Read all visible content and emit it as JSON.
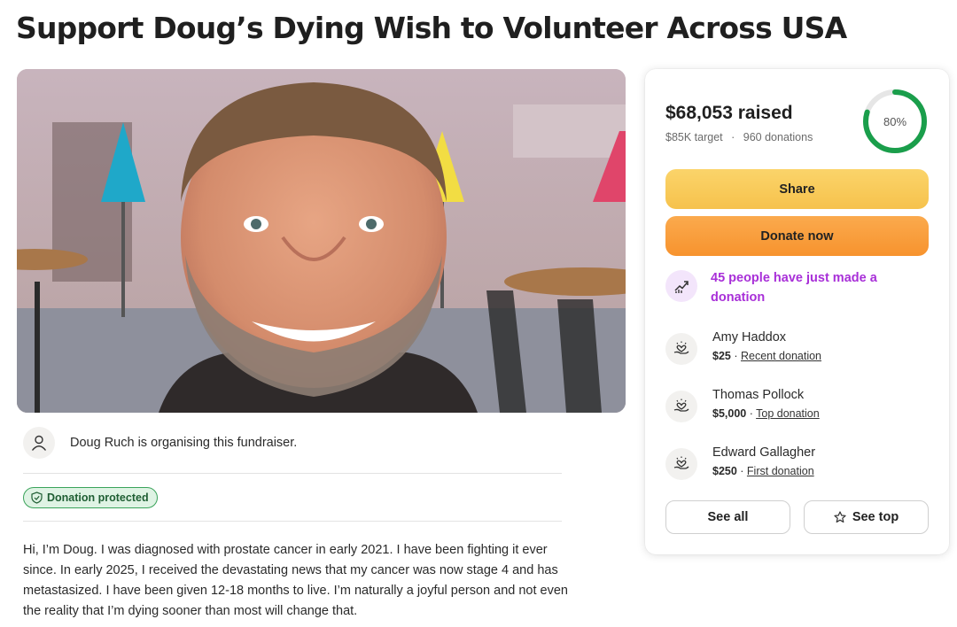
{
  "page": {
    "title": "Support Doug’s Dying Wish to Volunteer Across USA"
  },
  "organiser": {
    "text": "Doug Ruch is organising this fundraiser."
  },
  "badge": {
    "label": "Donation protected"
  },
  "story": {
    "text": "Hi, I’m Doug. I was diagnosed with prostate cancer in early 2021. I have been fighting it ever since. In early 2025, I received the devastating news that my cancer was now stage 4 and has metastasized. I have been given 12-18 months to live. I’m naturally a joyful person and not even the reality that I’m dying sooner than most will change that."
  },
  "progress": {
    "raised": "$68,053 raised",
    "target": "$85K target",
    "separator": "·",
    "donations": "960 donations",
    "percent_label": "80%",
    "fraction": 0.8
  },
  "actions": {
    "share": "Share",
    "donate": "Donate now",
    "see_all": "See all",
    "see_top": "See top"
  },
  "activity": {
    "text": "45 people have just made a donation"
  },
  "donors": [
    {
      "name": "Amy Haddox",
      "amount": "$25",
      "separator": " · ",
      "tag": "Recent donation"
    },
    {
      "name": "Thomas Pollock",
      "amount": "$5,000",
      "separator": " · ",
      "tag": "Top donation"
    },
    {
      "name": "Edward Gallagher",
      "amount": "$250",
      "separator": " · ",
      "tag": "First donation"
    }
  ],
  "colors": {
    "ring_progress": "#1a9e4b",
    "ring_track": "#e6e6e6",
    "share": "#f6c24c",
    "donate": "#f7932e",
    "activity_text": "#a82fd8",
    "badge_bg": "#dff3e4",
    "badge_border": "#3aa35a"
  },
  "icons": {
    "organiser": "user-icon",
    "badge": "shield-check-icon",
    "activity": "trending-up-icon",
    "donor": "heart-hand-icon",
    "see_top": "star-icon"
  }
}
